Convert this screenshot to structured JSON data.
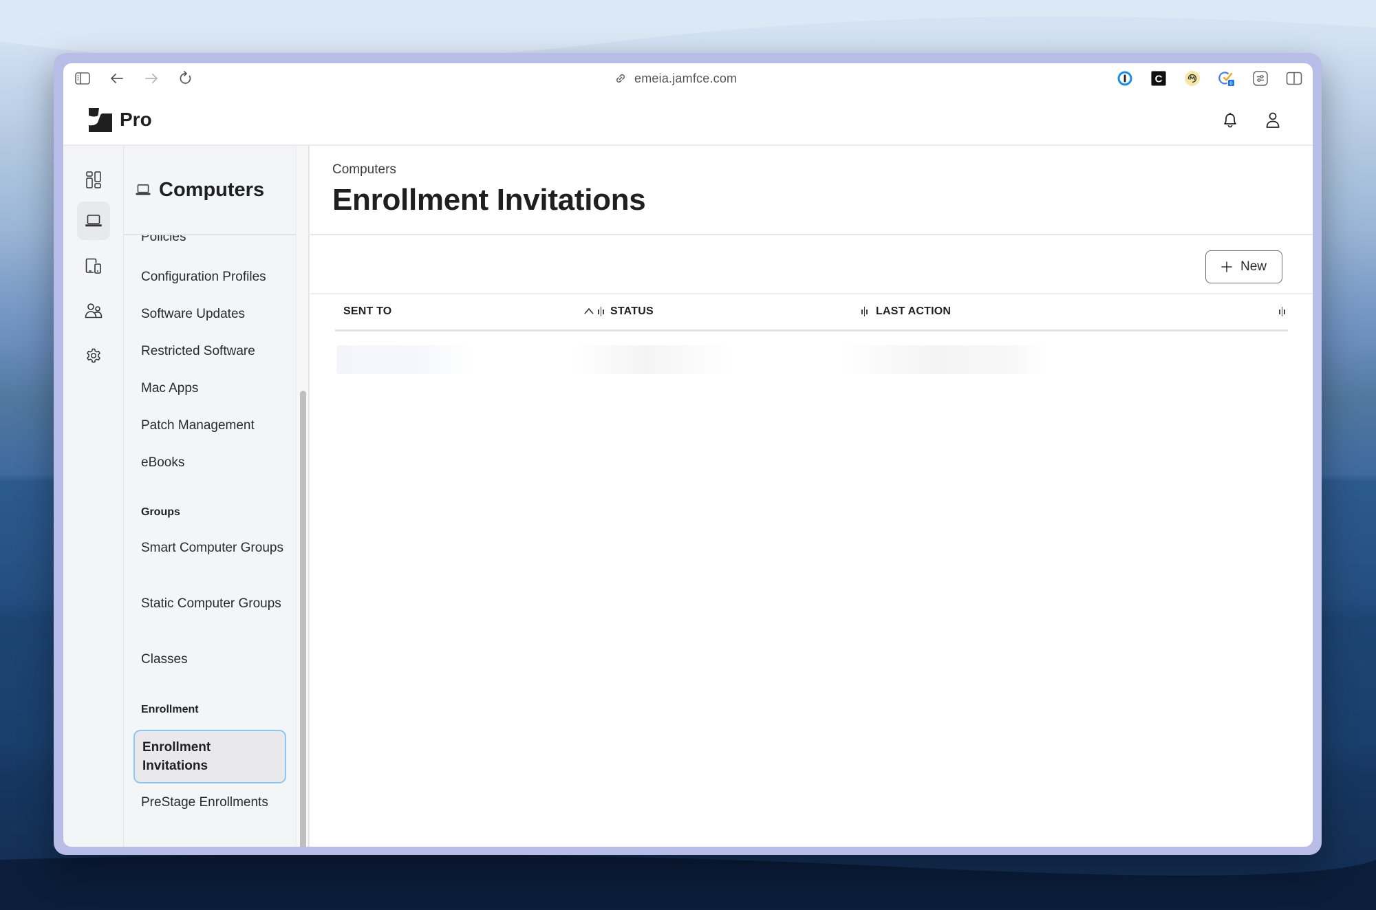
{
  "browser": {
    "url": "emeia.jamfce.com",
    "icons": {
      "sidebar_toggle": "sidebar-toggle-icon",
      "back": "arrow-left-icon",
      "forward": "arrow-right-icon",
      "reload": "reload-icon",
      "link": "link-icon",
      "extensions": [
        "1password-icon",
        "c-extension-icon",
        "m-extension-icon",
        "tasks-extension-icon",
        "sliders-extension-icon"
      ],
      "split_view": "split-view-icon"
    },
    "extension_badge": "0"
  },
  "app": {
    "product_name": "Pro",
    "header_icons": [
      "bell-icon",
      "user-icon"
    ]
  },
  "rail": {
    "items": [
      {
        "name": "dashboard",
        "icon": "dashboard-icon",
        "active": false
      },
      {
        "name": "computers",
        "icon": "laptop-icon",
        "active": true
      },
      {
        "name": "devices",
        "icon": "mobile-devices-icon",
        "active": false
      },
      {
        "name": "users",
        "icon": "users-icon",
        "active": false
      },
      {
        "name": "settings",
        "icon": "gear-icon",
        "active": false
      }
    ]
  },
  "subnav": {
    "title": "Computers",
    "items": [
      {
        "label": "Policies"
      },
      {
        "label": "Configuration Profiles"
      },
      {
        "label": "Software Updates"
      },
      {
        "label": "Restricted Software"
      },
      {
        "label": "Mac Apps"
      },
      {
        "label": "Patch Management"
      },
      {
        "label": "eBooks"
      }
    ],
    "groups_heading": "Groups",
    "group_items": [
      {
        "label": "Smart Computer Groups"
      },
      {
        "label": "Static Computer Groups"
      },
      {
        "label": "Classes"
      }
    ],
    "enrollment_heading": "Enrollment",
    "enrollment_items": [
      {
        "label": "Enrollment Invitations",
        "active": true
      },
      {
        "label": "PreStage Enrollments",
        "active": false
      }
    ]
  },
  "main": {
    "breadcrumb": "Computers",
    "title": "Enrollment Invitations",
    "new_button": "New",
    "table": {
      "columns": [
        {
          "label": "SENT TO",
          "sorted": "ascending"
        },
        {
          "label": "STATUS"
        },
        {
          "label": "LAST ACTION"
        }
      ],
      "state": "loading"
    }
  }
}
